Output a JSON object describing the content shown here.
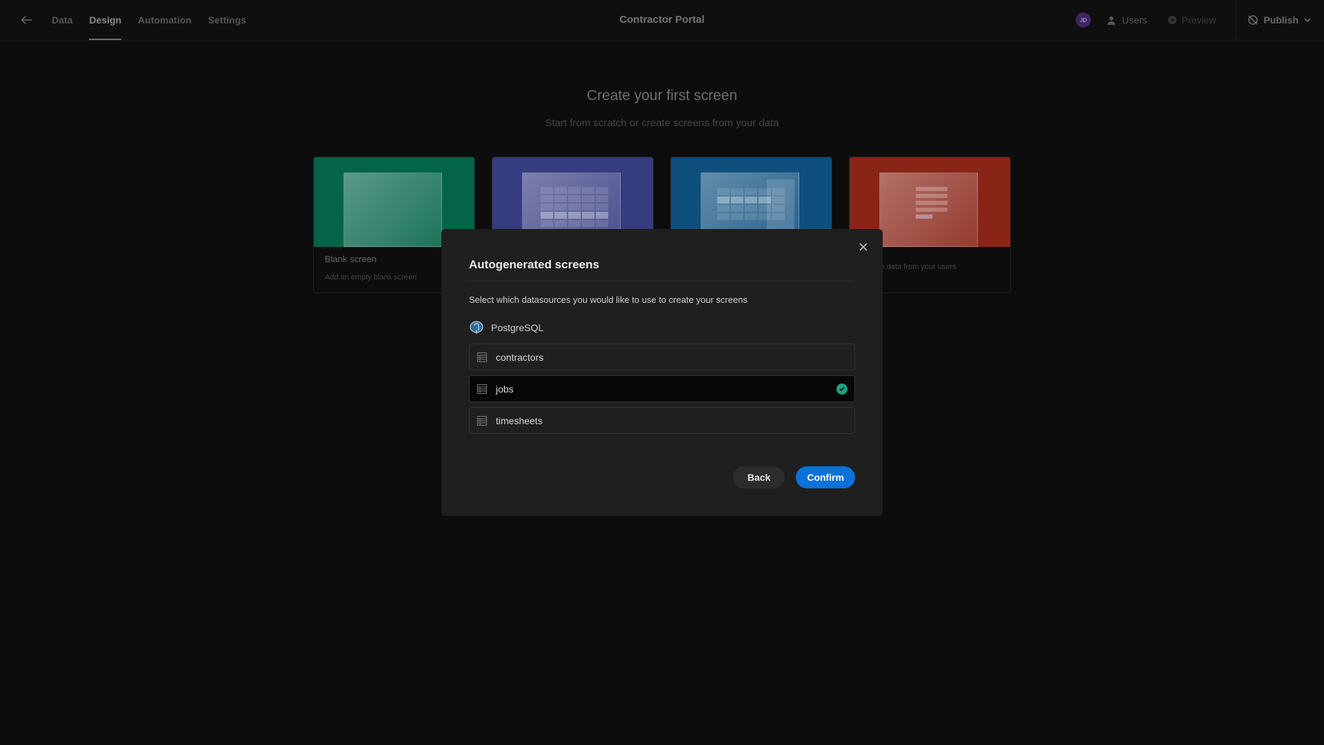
{
  "header": {
    "back_icon": "arrow-left-icon",
    "nav": [
      {
        "label": "Data",
        "active": false
      },
      {
        "label": "Design",
        "active": true
      },
      {
        "label": "Automation",
        "active": false
      },
      {
        "label": "Settings",
        "active": false
      }
    ],
    "app_title": "Contractor Portal",
    "avatar_initials": "JD",
    "avatar_color": "#3f2462",
    "users_label": "Users",
    "preview_label": "Preview",
    "publish_label": "Publish"
  },
  "hero": {
    "title": "Create your first screen",
    "subtitle": "Start from scratch or create screens from your data"
  },
  "cards": [
    {
      "title": "Blank screen",
      "description": "Add an empty blank screen",
      "color": "#036448"
    },
    {
      "title": "",
      "description": "",
      "color": "#353c80"
    },
    {
      "title": "",
      "description": "",
      "color": "#0f4f7e"
    },
    {
      "title": "",
      "description": "re data from your users",
      "color": "#892517"
    }
  ],
  "modal": {
    "title": "Autogenerated screens",
    "subtitle": "Select which datasources you would like to use to create your screens",
    "datasource": {
      "name": "PostgreSQL",
      "icon": "postgresql-icon"
    },
    "tables": [
      {
        "name": "contractors",
        "selected": false
      },
      {
        "name": "jobs",
        "selected": true
      },
      {
        "name": "timesheets",
        "selected": false
      }
    ],
    "back_label": "Back",
    "confirm_label": "Confirm",
    "accent_color": "#0a72d9",
    "selected_color": "#1aa37c"
  }
}
